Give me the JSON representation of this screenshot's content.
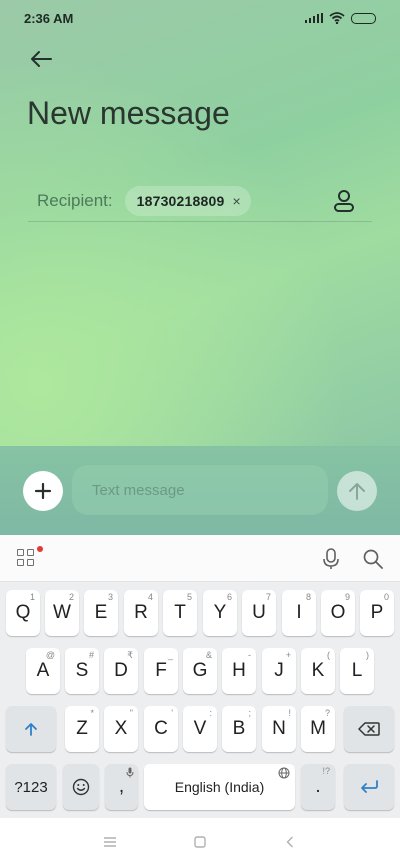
{
  "status_bar": {
    "time": "2:36 AM",
    "icons": [
      "signal-icon",
      "wifi-icon",
      "battery-icon"
    ]
  },
  "header": {
    "back_icon": "arrow-left-icon",
    "title": "New message"
  },
  "recipient": {
    "label": "Recipient:",
    "chips": [
      {
        "number": "18730218809",
        "remove_glyph": "×"
      }
    ],
    "contact_icon": "person-icon"
  },
  "compose": {
    "attach_icon": "plus-icon",
    "placeholder": "Text message",
    "value": "",
    "send_icon": "arrow-up-icon"
  },
  "keyboard_toolbar": {
    "icons": [
      "apps-grid-icon",
      "microphone-icon",
      "search-icon"
    ]
  },
  "keyboard": {
    "row1": [
      {
        "label": "Q",
        "hint": "1"
      },
      {
        "label": "W",
        "hint": "2"
      },
      {
        "label": "E",
        "hint": "3"
      },
      {
        "label": "R",
        "hint": "4"
      },
      {
        "label": "T",
        "hint": "5"
      },
      {
        "label": "Y",
        "hint": "6"
      },
      {
        "label": "U",
        "hint": "7"
      },
      {
        "label": "I",
        "hint": "8"
      },
      {
        "label": "O",
        "hint": "9"
      },
      {
        "label": "P",
        "hint": "0"
      }
    ],
    "row2": [
      {
        "label": "A",
        "hint": "@"
      },
      {
        "label": "S",
        "hint": "#"
      },
      {
        "label": "D",
        "hint": "₹"
      },
      {
        "label": "F",
        "hint": "_"
      },
      {
        "label": "G",
        "hint": "&"
      },
      {
        "label": "H",
        "hint": "-"
      },
      {
        "label": "J",
        "hint": "+"
      },
      {
        "label": "K",
        "hint": "("
      },
      {
        "label": "L",
        "hint": ")"
      }
    ],
    "row3": [
      {
        "label": "Z",
        "hint": "*"
      },
      {
        "label": "X",
        "hint": "\""
      },
      {
        "label": "C",
        "hint": "'"
      },
      {
        "label": "V",
        "hint": ":"
      },
      {
        "label": "B",
        "hint": ";"
      },
      {
        "label": "N",
        "hint": "!"
      },
      {
        "label": "M",
        "hint": "?"
      }
    ],
    "symbols_key": "?123",
    "comma_key": ",",
    "space_label": "English (India)",
    "period_key": ".",
    "period_hint": "!?"
  },
  "colors": {
    "accent": "#2f80c8",
    "app_background": "#9ccfa8",
    "keyboard_background": "#eceef0"
  }
}
